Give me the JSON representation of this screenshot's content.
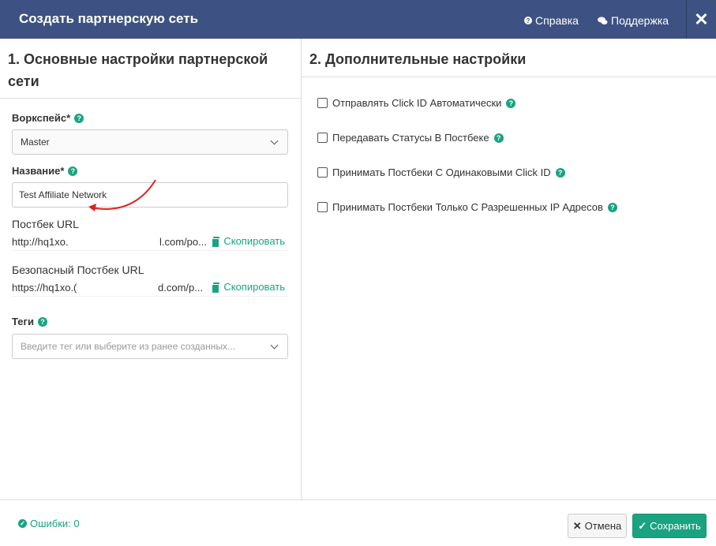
{
  "header": {
    "title": "Создать партнерскую сеть",
    "help_label": "Справка",
    "support_label": "Поддержка",
    "close_symbol": "✕"
  },
  "left_panel": {
    "title": "1. Основные настройки партнерской сети",
    "workspace": {
      "label": "Воркспейс*",
      "value": "Master"
    },
    "name": {
      "label": "Название*",
      "value": "Test Affiliate Network"
    },
    "postback": {
      "label": "Постбек URL",
      "url_start": "http://hq1xo.",
      "url_end": "l.com/po...",
      "copy_label": "Скопировать"
    },
    "secure_postback": {
      "label": "Безопасный Постбек URL",
      "url_start": "https://hq1xo.(",
      "url_end": "d.com/p...",
      "copy_label": "Скопировать"
    },
    "tags": {
      "label": "Теги",
      "placeholder": "Введите тег или выберите из ранее созданных..."
    }
  },
  "right_panel": {
    "title": "2. Дополнительные настройки",
    "options": [
      {
        "label": "Отправлять Click ID Автоматически",
        "checked": false
      },
      {
        "label": "Передавать Статусы В Постбеке",
        "checked": false
      },
      {
        "label": "Принимать Постбеки С Одинаковыми Click ID",
        "checked": false
      },
      {
        "label": "Принимать Постбеки Только С Разрешенных IP Адресов",
        "checked": false
      }
    ]
  },
  "footer": {
    "errors_label": "Ошибки: 0",
    "cancel_label": "Отмена",
    "save_label": "Сохранить"
  },
  "colors": {
    "header_bg": "#3d5282",
    "accent": "#1aa381",
    "annotation": "#e02020"
  },
  "icons": {
    "help": "question-circle-icon",
    "support": "chat-bubbles-icon",
    "close": "close-icon",
    "copy": "copy-icon",
    "errors": "check-circle-icon",
    "cancel": "times-icon",
    "save": "check-icon"
  }
}
